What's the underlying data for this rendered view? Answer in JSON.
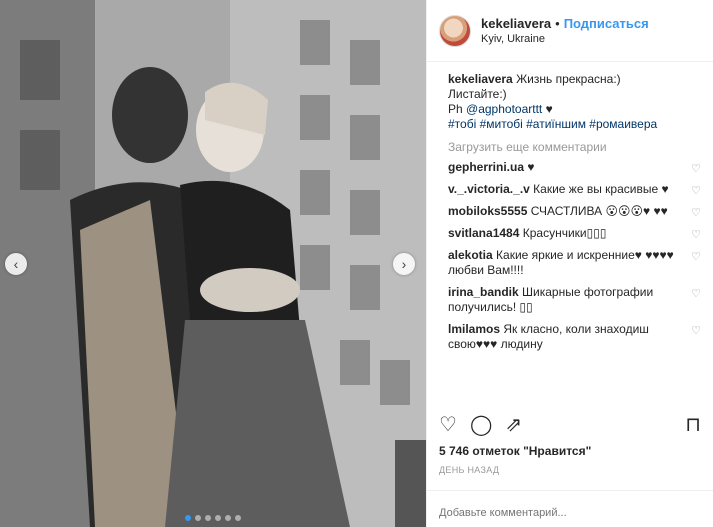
{
  "post": {
    "photo_dots_count": 6,
    "active_dot": 0
  },
  "header": {
    "username": "kekeliavera",
    "separator": "•",
    "follow_label": "Подписаться",
    "location": "Kyiv, Ukraine"
  },
  "caption": {
    "username": "kekeliavera",
    "text1": "Жизнь прекрасна:)",
    "text2": "Листайте:)",
    "text3_prefix": "Ph ",
    "mention": "@agphotoarttt",
    "text3_suffix": " ♥",
    "hashtags": "#тобі #митобі #атиїншим #ромаивера"
  },
  "load_more": "Загрузить еще комментарии",
  "comments": [
    {
      "username": "gepherrini.ua",
      "text": "♥"
    },
    {
      "username": "v._.victoria._.v",
      "text": "Какие же вы красивые ♥"
    },
    {
      "username": "mobiloks5555",
      "text": "СЧАСТЛИВА 😮😮😮♥ ♥♥"
    },
    {
      "username": "svitlana1484",
      "text": "Красунчики▯▯▯"
    },
    {
      "username": "alekotia",
      "text": "Какие яркие и искренние♥ ♥♥♥♥ любви Вам!!!!"
    },
    {
      "username": "irina_bandik",
      "text": "Шикарные фотографии получились! ▯▯"
    },
    {
      "username": "lmilamos",
      "text": "Як класно, коли знаходиш свою♥♥♥ людину"
    }
  ],
  "likes_count": "5 746",
  "likes_text": "отметок",
  "likes_quote": "\"Нравится\"",
  "time_ago": "ДЕНЬ НАЗАД",
  "add_comment_placeholder": "Добавьте комментарий...",
  "icons": {
    "heart": "♡",
    "comment": "◯",
    "share": "⇗",
    "bookmark": "⊓",
    "nav_left": "‹",
    "nav_right": "›"
  }
}
